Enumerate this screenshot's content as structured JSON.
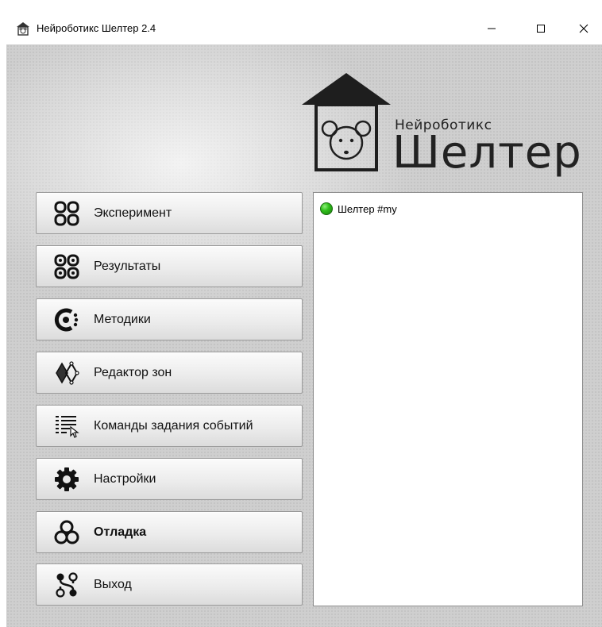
{
  "window": {
    "title": "Нейроботикс Шелтер 2.4",
    "controls": {
      "minimize": "—",
      "maximize": "☐",
      "close": "✕"
    }
  },
  "logo": {
    "subtitle": "Нейроботикс",
    "title": "Шелтер"
  },
  "menu": [
    {
      "label": "Эксперимент",
      "icon": "experiment-icon"
    },
    {
      "label": "Результаты",
      "icon": "results-icon"
    },
    {
      "label": "Методики",
      "icon": "methods-icon"
    },
    {
      "label": "Редактор зон",
      "icon": "zone-editor-icon"
    },
    {
      "label": "Команды задания событий",
      "icon": "event-commands-icon"
    },
    {
      "label": "Настройки",
      "icon": "settings-gear-icon"
    },
    {
      "label": "Отладка",
      "icon": "debug-icon",
      "bold": true
    },
    {
      "label": "Выход",
      "icon": "exit-icon"
    }
  ],
  "devices": [
    {
      "label": "Шелтер #my",
      "status": "online",
      "status_color": "#2fbf1a"
    }
  ]
}
